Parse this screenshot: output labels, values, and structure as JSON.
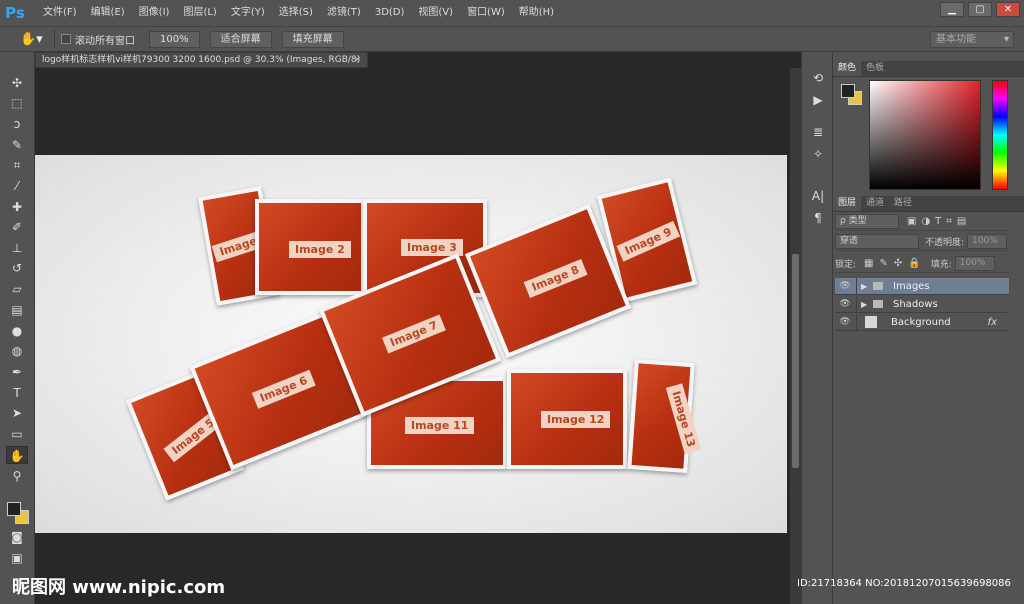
{
  "app": {
    "logo": "Ps"
  },
  "menus": [
    "文件(F)",
    "编辑(E)",
    "图像(I)",
    "图层(L)",
    "文字(Y)",
    "选择(S)",
    "滤镜(T)",
    "3D(D)",
    "视图(V)",
    "窗口(W)",
    "帮助(H)"
  ],
  "window_controls": [
    "▁",
    "▢",
    "✕"
  ],
  "options": {
    "checkbox_label": "滚动所有窗口",
    "zoom_btn": "100%",
    "fit_btn": "适合屏幕",
    "fill_btn": "填充屏幕",
    "workspace": "基本功能"
  },
  "document": {
    "tab": "logo样机标志样机vi样机79300 3200 1600.psd @ 30.3% (Images, RGB/8)",
    "close": "×"
  },
  "images": [
    "Image 1",
    "Image 2",
    "Image 3",
    "Image 9",
    "Image 8",
    "Image 7",
    "Image 6",
    "Image 5",
    "Image 11",
    "Image 12",
    "Image 13"
  ],
  "color_panel": {
    "tabs": [
      "颜色",
      "色板"
    ]
  },
  "layers_panel": {
    "tabs": [
      "图层",
      "通道",
      "路径"
    ],
    "filter": "ρ 类型",
    "blend": "穿透",
    "opacity_label": "不透明度:",
    "opacity": "100%",
    "lock_label": "锁定:",
    "fill_label": "填充:",
    "fill": "100%",
    "layers": [
      {
        "name": "Images",
        "type": "folder",
        "selected": true
      },
      {
        "name": "Shadows",
        "type": "folder",
        "selected": false
      },
      {
        "name": "Background",
        "type": "layer",
        "selected": false,
        "fx": "fx"
      }
    ]
  },
  "watermark": {
    "site": "昵图网 www.nipic.com",
    "id": "ID:21718364 NO:20181207015639698086"
  },
  "colors": {
    "accent": "#31a8ff",
    "selected_layer": "#6d7e95",
    "photo": "#c23a18",
    "fg_swatch": "#222222",
    "bg_swatch": "#e8c53a"
  }
}
